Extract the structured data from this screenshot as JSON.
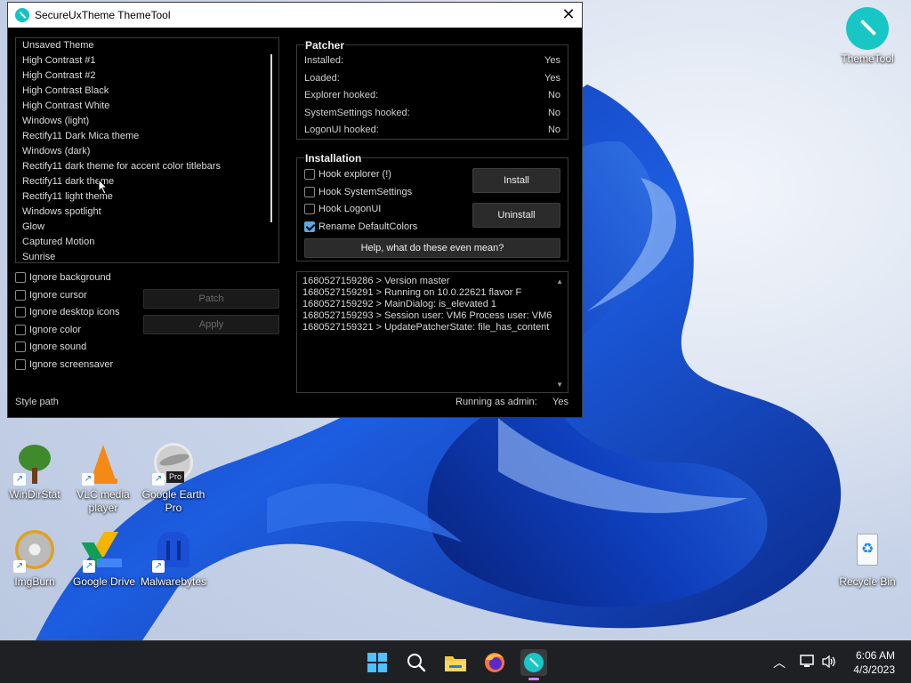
{
  "window": {
    "title": "SecureUxTheme ThemeTool"
  },
  "themes": [
    "Unsaved Theme",
    "High Contrast #1",
    "High Contrast #2",
    "High Contrast Black",
    "High Contrast White",
    "Windows (light)",
    "Rectify11 Dark Mica theme",
    "Windows (dark)",
    "Rectify11 dark theme for accent color titlebars",
    "Rectify11 dark theme",
    "Rectify11 light theme",
    "Windows spotlight",
    "Glow",
    "Captured Motion",
    "Sunrise"
  ],
  "ignore_options": [
    "Ignore background",
    "Ignore cursor",
    "Ignore desktop icons",
    "Ignore color",
    "Ignore sound",
    "Ignore screensaver"
  ],
  "buttons": {
    "patch": "Patch",
    "apply": "Apply",
    "install": "Install",
    "uninstall": "Uninstall",
    "help": "Help, what do these even mean?"
  },
  "patcher": {
    "title": "Patcher",
    "rows": [
      {
        "label": "Installed:",
        "value": "Yes"
      },
      {
        "label": "Loaded:",
        "value": "Yes"
      },
      {
        "label": "Explorer hooked:",
        "value": "No"
      },
      {
        "label": "SystemSettings hooked:",
        "value": "No"
      },
      {
        "label": "LogonUI hooked:",
        "value": "No"
      }
    ]
  },
  "installation": {
    "title": "Installation",
    "options": [
      {
        "label": "Hook explorer (!)",
        "checked": false
      },
      {
        "label": "Hook SystemSettings",
        "checked": false
      },
      {
        "label": "Hook LogonUI",
        "checked": false
      },
      {
        "label": "Rename DefaultColors",
        "checked": true
      }
    ]
  },
  "log": [
    "1680527159286 > Version master",
    "1680527159291 > Running on 10.0.22621 flavor F",
    "1680527159292 > MainDialog: is_elevated 1",
    "1680527159293 > Session user: VM6 Process user: VM6",
    "1680527159321 > UpdatePatcherState: file_has_content"
  ],
  "footer": {
    "style_path": "Style path",
    "admin_label": "Running as admin:",
    "admin_value": "Yes"
  },
  "desktop_icons": {
    "themetool": "ThemeTool",
    "windirstat": "WinDirStat",
    "vlc": "VLC media player",
    "google_earth": "Google Earth Pro",
    "google_earth_badge": "Pro",
    "imgburn": "ImgBurn",
    "google_drive": "Google Drive",
    "malwarebytes": "Malwarebytes",
    "recycle_bin": "Recycle Bin"
  },
  "clock": {
    "time": "6:06 AM",
    "date": "4/3/2023"
  },
  "colors": {
    "accent": "#12c4c4",
    "checked": "#5aa9e6",
    "taskbar": "#1f2023"
  }
}
